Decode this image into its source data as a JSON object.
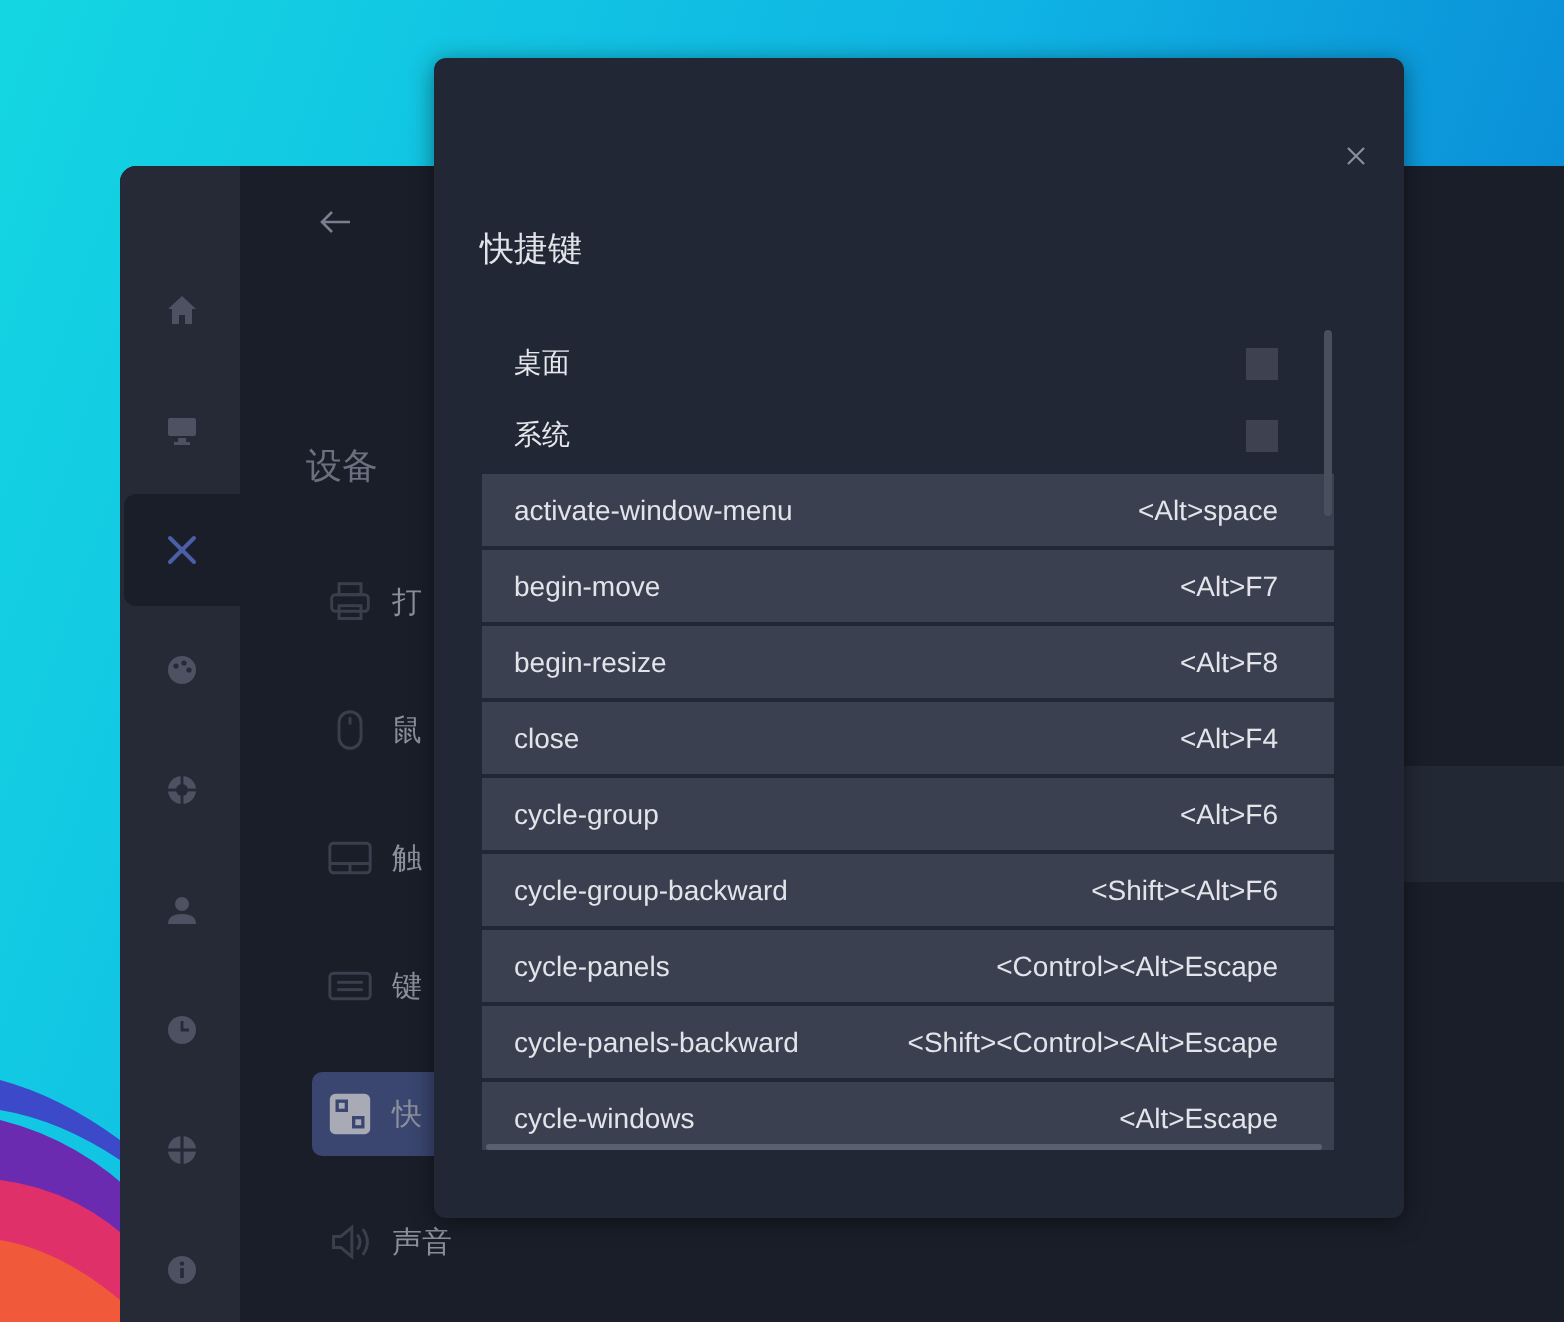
{
  "settings_window": {
    "sidebar": {
      "items": [
        {
          "selected": false
        },
        {
          "selected": false
        },
        {
          "selected": true
        },
        {
          "selected": false
        },
        {
          "selected": false
        },
        {
          "selected": false
        },
        {
          "selected": false
        },
        {
          "selected": false
        },
        {
          "selected": false
        }
      ]
    },
    "heading": "设备",
    "items": [
      {
        "label": "打",
        "selected": false
      },
      {
        "label": "鼠",
        "selected": false
      },
      {
        "label": "触",
        "selected": false
      },
      {
        "label": "键",
        "selected": false
      },
      {
        "label": "快",
        "selected": true
      },
      {
        "label": "声音",
        "selected": false
      }
    ]
  },
  "dialog": {
    "title": "快捷键",
    "groups": [
      {
        "label": "桌面"
      },
      {
        "label": "系统"
      }
    ],
    "shortcuts": [
      {
        "name": "activate-window-menu",
        "keys": "<Alt>space"
      },
      {
        "name": "begin-move",
        "keys": "<Alt>F7"
      },
      {
        "name": "begin-resize",
        "keys": "<Alt>F8"
      },
      {
        "name": "close",
        "keys": "<Alt>F4"
      },
      {
        "name": "cycle-group",
        "keys": "<Alt>F6"
      },
      {
        "name": "cycle-group-backward",
        "keys": "<Shift><Alt>F6"
      },
      {
        "name": "cycle-panels",
        "keys": "<Control><Alt>Escape"
      },
      {
        "name": "cycle-panels-backward",
        "keys": "<Shift><Control><Alt>Escape"
      },
      {
        "name": "cycle-windows",
        "keys": "<Alt>Escape"
      }
    ]
  }
}
